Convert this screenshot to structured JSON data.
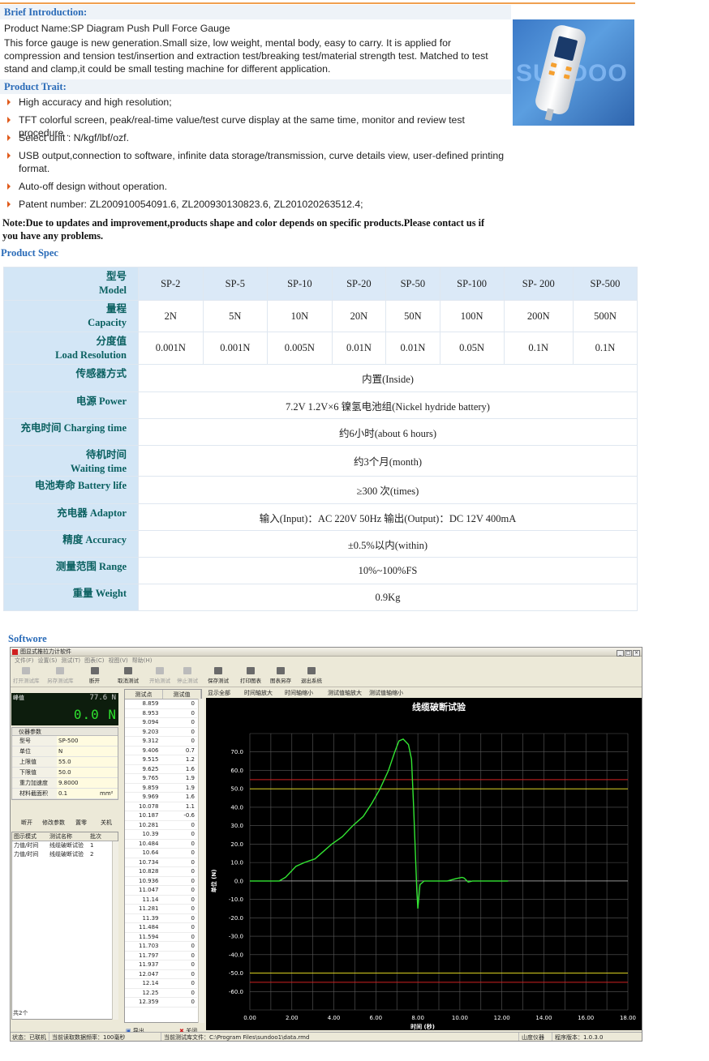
{
  "intro": {
    "heading": "Brief Introduction:",
    "product_name": "Product Name:SP Diagram Push Pull Force Gauge",
    "text": "This force gauge is new generation.Small size, low weight, mental body, easy to carry. It is applied for compression and tension test/insertion and extraction test/breaking test/material strength test. Matched to test stand and clamp,it could be small testing machine for different application.",
    "image_brand": "SUNDOO"
  },
  "trait": {
    "heading": "Product Trait:",
    "items": [
      "High accuracy and high resolution;",
      "TFT colorful screen, peak/real-time value/test curve display at the same time, monitor and review test procedure .",
      "Select unit : N/kgf/lbf/ozf.",
      "USB output,connection to software, infinite data storage/transmission, curve details view, user-defined printing format.",
      "Auto-off design without operation.",
      "Patent number: ZL200910054091.6, ZL200930130823.6, ZL201020263512.4;"
    ],
    "note": "Note:Due to updates and improvement,products shape and color depends on specific products.Please contact us if you have any problems."
  },
  "spec": {
    "heading": "Product Spec",
    "header_row": {
      "label_cn": "型号",
      "label_en": "Model",
      "values": [
        "SP-2",
        "SP-5",
        "SP-10",
        "SP-20",
        "SP-50",
        "SP-100",
        "SP- 200",
        "SP-500"
      ]
    },
    "multi_rows": [
      {
        "label_cn": "量程",
        "label_en": "Capacity",
        "values": [
          "2N",
          "5N",
          "10N",
          "20N",
          "50N",
          "100N",
          "200N",
          "500N"
        ]
      },
      {
        "label_cn": "分度值",
        "label_en": "Load Resolution",
        "values": [
          "0.001N",
          "0.001N",
          "0.005N",
          "0.01N",
          "0.01N",
          "0.05N",
          "0.1N",
          "0.1N"
        ]
      }
    ],
    "span_rows": [
      {
        "label": "传感器方式",
        "value": "内置(Inside)"
      },
      {
        "label": "电源   Power",
        "value": "7.2V 1.2V×6 镍氢电池组(Nickel hydride battery)"
      },
      {
        "label": "充电时间   Charging time",
        "value": "约6小时(about 6 hours)"
      },
      {
        "label": "待机时间",
        "label2": "Waiting time",
        "value": "约3个月(month)"
      },
      {
        "label": "电池寿命   Battery life",
        "value": "≥300 次(times)"
      },
      {
        "label": "充电器   Adaptor",
        "value": "输入(Input)：AC 220V 50Hz  输出(Output)：DC 12V 400mA"
      },
      {
        "label": "精度   Accuracy",
        "value": "±0.5%以内(within)"
      },
      {
        "label": "测量范围   Range",
        "value": "10%~100%FS"
      },
      {
        "label": "重量   Weight",
        "value": "0.9Kg"
      }
    ]
  },
  "software": {
    "heading": "Softwore",
    "window_title": "图显式推拉力计软件",
    "menu": [
      "文件(F)",
      "设置(S)",
      "测试(T)",
      "图表(C)",
      "视图(V)",
      "帮助(H)"
    ],
    "toolbar": [
      {
        "label": "打开测试库",
        "enabled": false
      },
      {
        "label": "另存测试库",
        "enabled": false
      },
      {
        "label": "断开",
        "enabled": true
      },
      {
        "label": "取消测试",
        "enabled": true
      },
      {
        "label": "开始测试",
        "enabled": false
      },
      {
        "label": "停止测试",
        "enabled": false
      },
      {
        "label": "保存测试",
        "enabled": true
      },
      {
        "label": "打印图表",
        "enabled": true
      },
      {
        "label": "图表另存",
        "enabled": true
      },
      {
        "label": "退出系统",
        "enabled": true
      }
    ],
    "readout": {
      "label": "峰值",
      "small": "77.6 N",
      "big": "0.0 N"
    },
    "params": {
      "title": "仪器参数",
      "rows": [
        {
          "k": "型号",
          "v": "SP-500",
          "u": ""
        },
        {
          "k": "单位",
          "v": "N",
          "u": ""
        },
        {
          "k": "上限值",
          "v": "55.0",
          "u": ""
        },
        {
          "k": "下限值",
          "v": "50.0",
          "u": ""
        },
        {
          "k": "重力加速度",
          "v": "9.8000",
          "u": ""
        },
        {
          "k": "材料截面积",
          "v": "0.1",
          "u": "mm²"
        }
      ]
    },
    "buttons": [
      "断开",
      "修改参数",
      "置零",
      "关机"
    ],
    "file_list": {
      "columns": [
        "图示模式",
        "测试名称",
        "批次"
      ],
      "rows": [
        [
          "力值/时间",
          "线缆破断试验",
          "1"
        ],
        [
          "力值/时间",
          "线缆破断试验",
          "2"
        ]
      ],
      "footer": "共2个"
    },
    "data_table": {
      "columns": [
        "测试点",
        "测试值"
      ],
      "rows": [
        [
          "8.859",
          "0"
        ],
        [
          "8.953",
          "0"
        ],
        [
          "9.094",
          "0"
        ],
        [
          "9.203",
          "0"
        ],
        [
          "9.312",
          "0"
        ],
        [
          "9.406",
          "0.7"
        ],
        [
          "9.515",
          "1.2"
        ],
        [
          "9.625",
          "1.6"
        ],
        [
          "9.765",
          "1.9"
        ],
        [
          "9.859",
          "1.9"
        ],
        [
          "9.969",
          "1.6"
        ],
        [
          "10.078",
          "1.1"
        ],
        [
          "10.187",
          "-0.6"
        ],
        [
          "10.281",
          "0"
        ],
        [
          "10.39",
          "0"
        ],
        [
          "10.484",
          "0"
        ],
        [
          "10.64",
          "0"
        ],
        [
          "10.734",
          "0"
        ],
        [
          "10.828",
          "0"
        ],
        [
          "10.936",
          "0"
        ],
        [
          "11.047",
          "0"
        ],
        [
          "11.14",
          "0"
        ],
        [
          "11.281",
          "0"
        ],
        [
          "11.39",
          "0"
        ],
        [
          "11.484",
          "0"
        ],
        [
          "11.594",
          "0"
        ],
        [
          "11.703",
          "0"
        ],
        [
          "11.797",
          "0"
        ],
        [
          "11.937",
          "0"
        ],
        [
          "12.047",
          "0"
        ],
        [
          "12.14",
          "0"
        ],
        [
          "12.25",
          "0"
        ],
        [
          "12.359",
          "0"
        ]
      ]
    },
    "bottom_buttons": {
      "export": "导出",
      "close": "关闭"
    },
    "chart_tabs": [
      "显示全部",
      "时间轴放大",
      "时间轴缩小",
      "测试值轴放大",
      "测试值轴缩小"
    ],
    "status": {
      "state": "状态：已联机",
      "rate": "当前读取数据频率：100毫秒",
      "file": "当前测试库文件：C:\\Program Files\\sundoo1\\data.rmd",
      "company": "山度仪器",
      "version": "程序版本：1.0.3.0"
    }
  },
  "chart_data": {
    "type": "line",
    "title": "线缆破断试验",
    "xlabel": "时间 (秒)",
    "ylabel": "单位 (N)",
    "xlim": [
      0,
      18
    ],
    "ylim": [
      -70,
      80
    ],
    "x_ticks": [
      "0.00",
      "2.00",
      "4.00",
      "6.00",
      "8.00",
      "10.00",
      "12.00",
      "14.00",
      "16.00",
      "18.00"
    ],
    "y_ticks": [
      "70.0",
      "60.0",
      "50.0",
      "40.0",
      "30.0",
      "20.0",
      "10.0",
      "0.0",
      "-10.0",
      "-20.0",
      "-30.0",
      "-40.0",
      "-50.0",
      "-60.0"
    ],
    "upper_limit": 55,
    "lower_limit": 50,
    "grid": true,
    "series": [
      {
        "color": "#33e633",
        "x": [
          0.0,
          1.4,
          1.7,
          2.2,
          2.6,
          3.1,
          3.4,
          3.9,
          4.4,
          4.9,
          5.4,
          5.8,
          6.2,
          6.6,
          6.9,
          7.1,
          7.3,
          7.55,
          7.7,
          7.8,
          7.9,
          7.95,
          8.0,
          8.1,
          8.3,
          8.8,
          9.4,
          9.8,
          10.1,
          10.2,
          10.4,
          10.6,
          11.0,
          12.3
        ],
        "y": [
          0,
          0,
          2,
          8,
          10,
          12,
          15,
          20,
          24,
          30,
          35,
          42,
          50,
          60,
          70,
          76,
          77,
          74,
          66,
          40,
          10,
          -5,
          -15,
          -2,
          0,
          0,
          0,
          1.2,
          1.9,
          1.6,
          -0.6,
          0,
          0,
          0
        ]
      }
    ]
  }
}
